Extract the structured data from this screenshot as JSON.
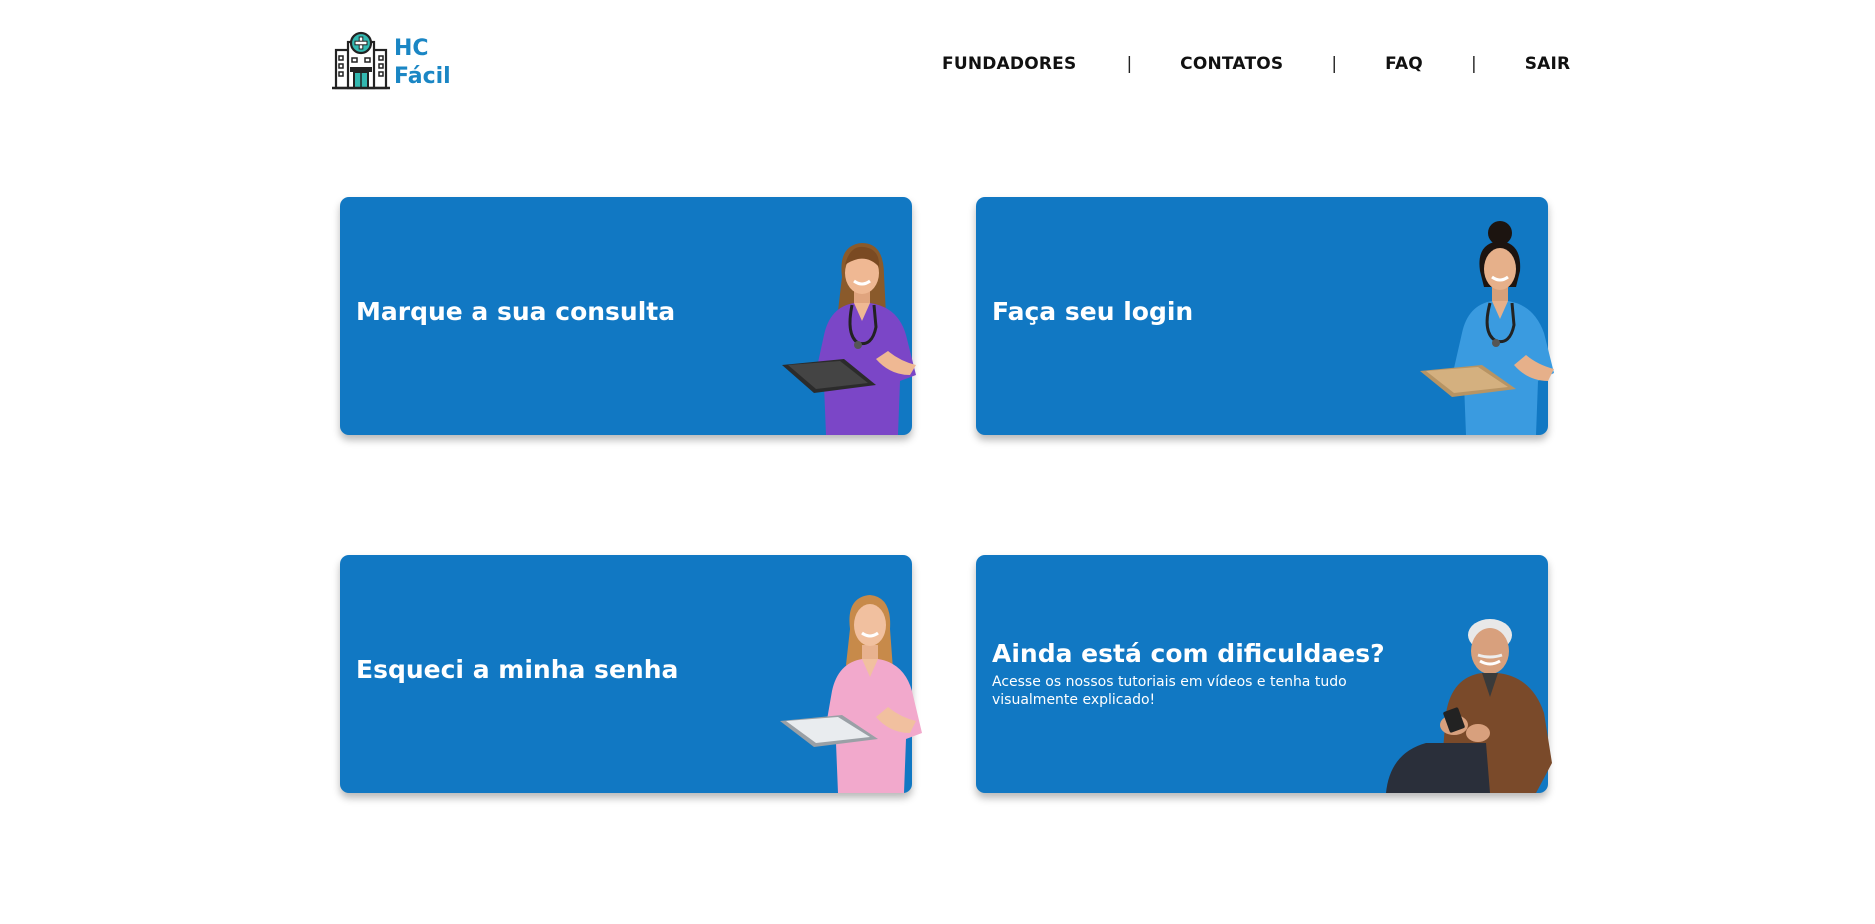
{
  "header": {
    "logo": {
      "line1": "HC",
      "line2": "Fácil",
      "icon": "hospital-building-icon"
    },
    "nav": {
      "items": [
        {
          "label": "FUNDADORES"
        },
        {
          "label": "CONTATOS"
        },
        {
          "label": "FAQ"
        },
        {
          "label": "SAIR"
        }
      ],
      "separator": "|"
    }
  },
  "cards": [
    {
      "title": "Marque a sua consulta",
      "image": "nurse-purple-scrubs-illustration"
    },
    {
      "title": "Faça seu login",
      "image": "nurse-blue-scrubs-illustration"
    },
    {
      "title": "Esqueci a minha senha",
      "image": "nurse-pink-scrubs-illustration"
    },
    {
      "title": "Ainda está com dificuldaes?",
      "subtitle": "Acesse os nossos tutoriais em vídeos e tenha tudo visualmente explicado!",
      "image": "elderly-man-phone-illustration"
    }
  ],
  "colors": {
    "card_background": "#1178c3",
    "logo_text": "#1a86c4",
    "nav_text": "#111111",
    "page_background": "#ffffff"
  }
}
